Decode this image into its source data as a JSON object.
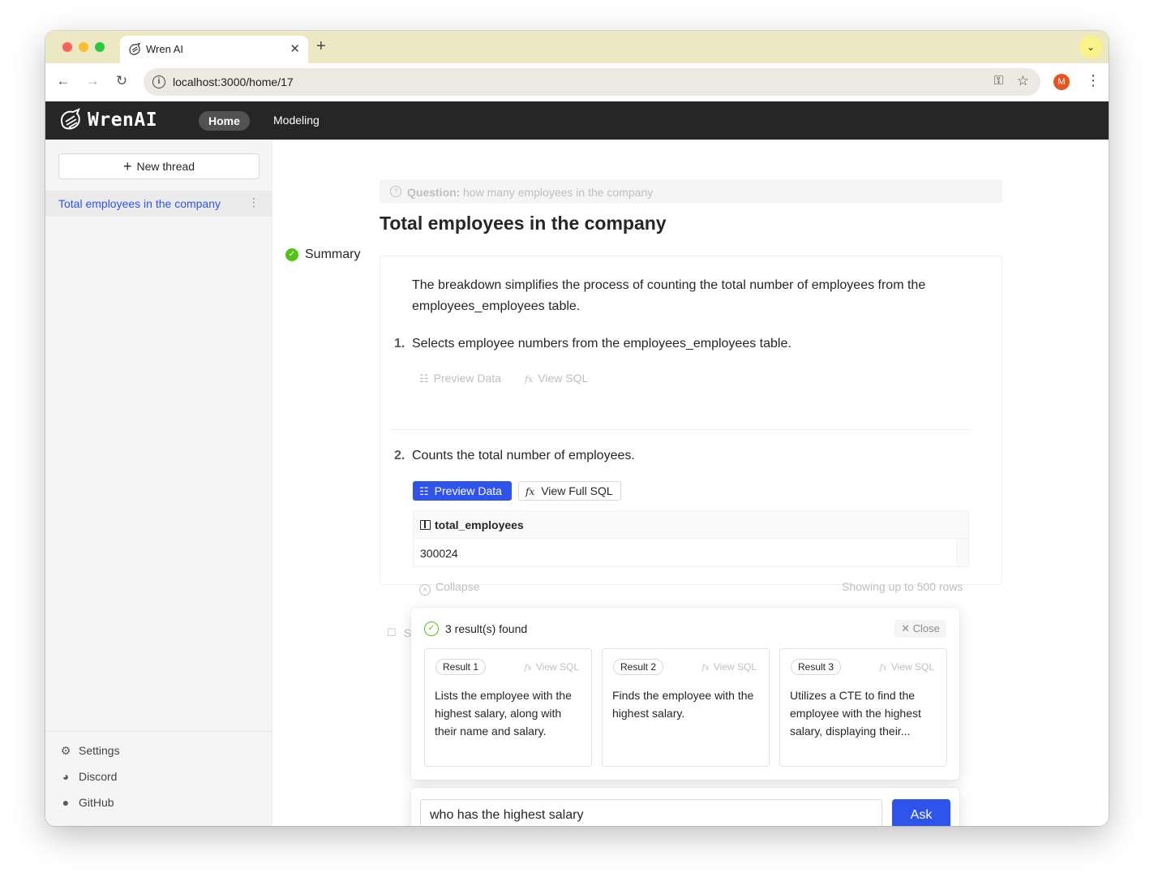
{
  "browser": {
    "tab_title": "Wren AI",
    "tab_close": "✕",
    "new_tab": "+",
    "url": "localhost:3000/home/17",
    "profile_initial": "M"
  },
  "app": {
    "brand": "WrenAI",
    "nav": {
      "home": "Home",
      "modeling": "Modeling"
    }
  },
  "sidebar": {
    "new_thread": "New thread",
    "threads": [
      {
        "label": "Total employees in the company"
      }
    ],
    "footer": [
      {
        "label": "Settings",
        "icon": "gear-icon"
      },
      {
        "label": "Discord",
        "icon": "discord-icon"
      },
      {
        "label": "GitHub",
        "icon": "github-icon"
      }
    ]
  },
  "thread": {
    "question_label": "Question:",
    "question": "how many employees in the company",
    "title": "Total employees in the company",
    "summary_title": "Summary",
    "summary": "The breakdown simplifies the process of counting the total number of employees from the employees_employees table.",
    "steps": [
      {
        "num": "1.",
        "text": "Selects employee numbers from the employees_employees table.",
        "preview": "Preview Data",
        "sql": "View SQL"
      },
      {
        "num": "2.",
        "text": "Counts the total number of employees.",
        "preview": "Preview Data",
        "sql": "View Full SQL"
      }
    ],
    "table": {
      "column": "total_employees",
      "value": "300024"
    },
    "collapse": "Collapse",
    "showing": "Showing up to 500 rows",
    "peek_text": "S"
  },
  "results": {
    "title": "3 result(s) found",
    "close": "Close",
    "items": [
      {
        "tag": "Result 1",
        "sql": "View SQL",
        "desc": "Lists the employee with the highest salary, along with their name and salary."
      },
      {
        "tag": "Result 2",
        "sql": "View SQL",
        "desc": "Finds the employee with the highest salary."
      },
      {
        "tag": "Result 3",
        "sql": "View SQL",
        "desc": "Utilizes a CTE to find the employee with the highest salary, displaying their..."
      }
    ]
  },
  "ask": {
    "value": "who has the highest salary",
    "button": "Ask"
  },
  "colors": {
    "primary": "#2f54eb",
    "success": "#52c41a",
    "header": "#262626",
    "tabstrip": "#ece8c4"
  }
}
